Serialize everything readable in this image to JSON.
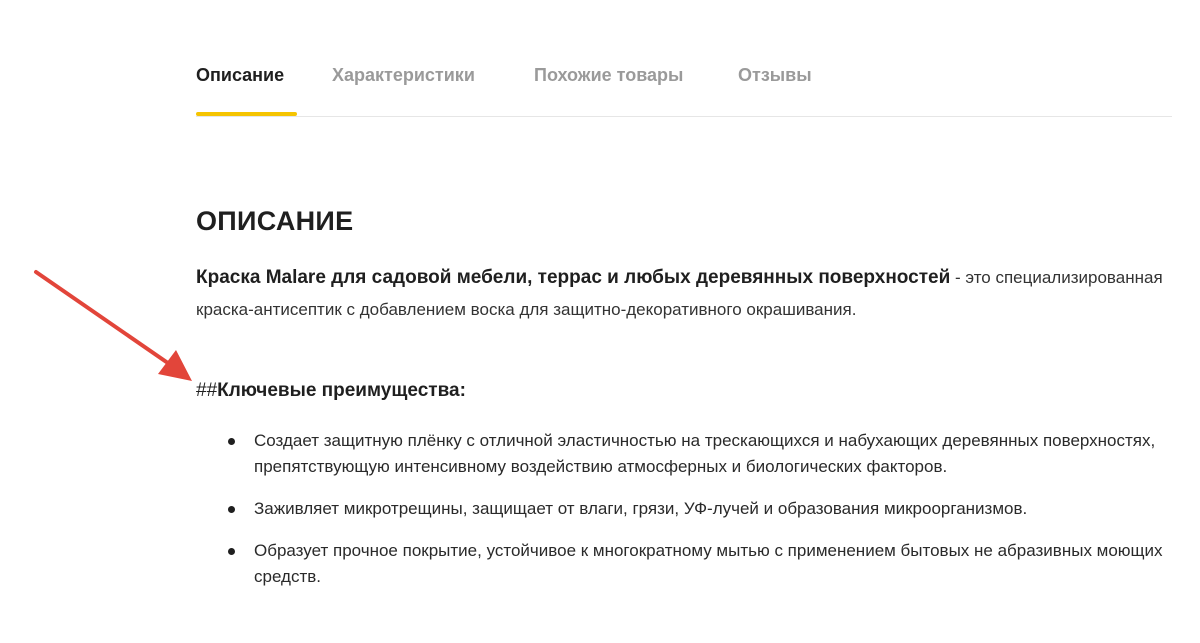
{
  "tabs": [
    {
      "label": "Описание",
      "active": true
    },
    {
      "label": "Характеристики",
      "active": false
    },
    {
      "label": "Похожие товары",
      "active": false
    },
    {
      "label": "Отзывы",
      "active": false
    }
  ],
  "content": {
    "section_title": "ОПИСАНИЕ",
    "intro_bold": "Краска Malare для садовой мебели, террас и любых деревянных поверхностей",
    "intro_rest": " - это специализированная краска-антисептик с добавлением воска для защитно-декоративного окрашивания.",
    "subheading_prefix": "##",
    "subheading_text": "Ключевые преимущества:",
    "benefits": [
      "Создает защитную плёнку с отличной эластичностью на трескающихся и набухающих деревянных поверхностях, препятствующую интенсивному воздействию атмосферных и биологических факторов.",
      "Заживляет микротрещины, защищает от влаги, грязи, УФ-лучей и образования микроорганизмов.",
      "Образует прочное покрытие, устойчивое к многократному мытью с применением бытовых не абразивных моющих средств."
    ]
  },
  "colors": {
    "accent_underline": "#f5c400",
    "arrow": "#e2453a",
    "inactive_tab": "#9a9a9a"
  },
  "icons": {
    "annotation": "red-arrow-icon",
    "list_bullet": "bullet-dot-icon"
  }
}
